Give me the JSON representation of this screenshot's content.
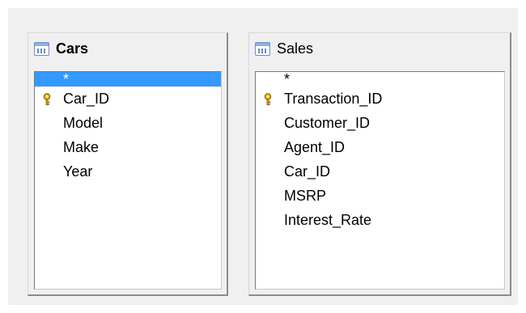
{
  "tables": [
    {
      "title": "Cars",
      "fields": [
        {
          "label": "*",
          "selected": true,
          "primary_key": false
        },
        {
          "label": "Car_ID",
          "selected": false,
          "primary_key": true
        },
        {
          "label": "Model",
          "selected": false,
          "primary_key": false
        },
        {
          "label": "Make",
          "selected": false,
          "primary_key": false
        },
        {
          "label": "Year",
          "selected": false,
          "primary_key": false
        }
      ]
    },
    {
      "title": "Sales",
      "fields": [
        {
          "label": "*",
          "selected": false,
          "primary_key": false
        },
        {
          "label": "Transaction_ID",
          "selected": false,
          "primary_key": true
        },
        {
          "label": "Customer_ID",
          "selected": false,
          "primary_key": false
        },
        {
          "label": "Agent_ID",
          "selected": false,
          "primary_key": false
        },
        {
          "label": "Car_ID",
          "selected": false,
          "primary_key": false
        },
        {
          "label": "MSRP",
          "selected": false,
          "primary_key": false
        },
        {
          "label": "Interest_Rate",
          "selected": false,
          "primary_key": false
        }
      ]
    }
  ],
  "colors": {
    "selection": "#3399ff",
    "key": "#e8b000"
  },
  "icons": {
    "table_icon": "table-icon",
    "key_icon": "primary-key-icon"
  }
}
